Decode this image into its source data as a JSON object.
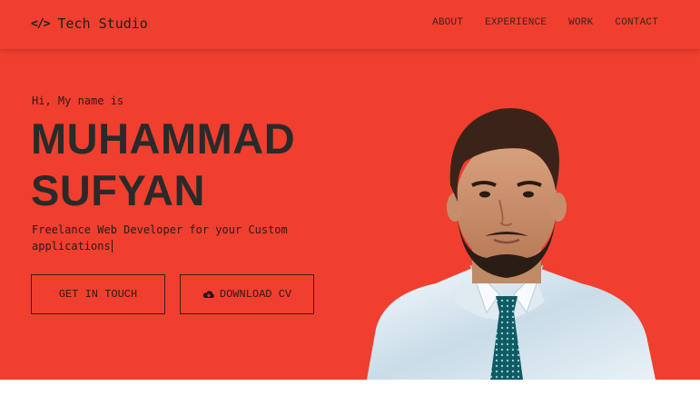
{
  "brand": {
    "icon": "</>",
    "name": "Tech Studio"
  },
  "nav": {
    "items": [
      "ABOUT",
      "EXPERIENCE",
      "WORK",
      "CONTACT"
    ]
  },
  "hero": {
    "intro": "Hi, My name is",
    "name_line1": "MUHAMMAD",
    "name_line2": "SUFYAN",
    "tagline": "Freelance Web Developer for your Custom applications",
    "buttons": {
      "touch": "GET IN TOUCH",
      "download": "DOWNLOAD CV"
    }
  },
  "icons": {
    "brand": "code-icon",
    "download": "cloud-download-icon"
  },
  "colors": {
    "background": "#f03f2e",
    "text": "#2a2a2a",
    "below": "#ffffff"
  }
}
